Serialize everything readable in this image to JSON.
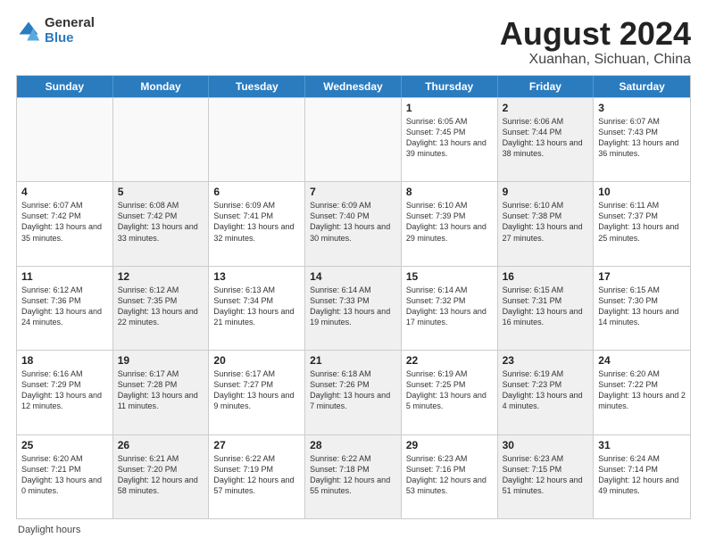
{
  "header": {
    "logo_general": "General",
    "logo_blue": "Blue",
    "title": "August 2024",
    "subtitle": "Xuanhan, Sichuan, China"
  },
  "days_of_week": [
    "Sunday",
    "Monday",
    "Tuesday",
    "Wednesday",
    "Thursday",
    "Friday",
    "Saturday"
  ],
  "weeks": [
    [
      {
        "day": "",
        "info": "",
        "empty": true
      },
      {
        "day": "",
        "info": "",
        "empty": true
      },
      {
        "day": "",
        "info": "",
        "empty": true
      },
      {
        "day": "",
        "info": "",
        "empty": true
      },
      {
        "day": "1",
        "info": "Sunrise: 6:05 AM\nSunset: 7:45 PM\nDaylight: 13 hours\nand 39 minutes.",
        "empty": false
      },
      {
        "day": "2",
        "info": "Sunrise: 6:06 AM\nSunset: 7:44 PM\nDaylight: 13 hours\nand 38 minutes.",
        "empty": false,
        "shaded": true
      },
      {
        "day": "3",
        "info": "Sunrise: 6:07 AM\nSunset: 7:43 PM\nDaylight: 13 hours\nand 36 minutes.",
        "empty": false
      }
    ],
    [
      {
        "day": "4",
        "info": "Sunrise: 6:07 AM\nSunset: 7:42 PM\nDaylight: 13 hours\nand 35 minutes.",
        "empty": false
      },
      {
        "day": "5",
        "info": "Sunrise: 6:08 AM\nSunset: 7:42 PM\nDaylight: 13 hours\nand 33 minutes.",
        "empty": false,
        "shaded": true
      },
      {
        "day": "6",
        "info": "Sunrise: 6:09 AM\nSunset: 7:41 PM\nDaylight: 13 hours\nand 32 minutes.",
        "empty": false
      },
      {
        "day": "7",
        "info": "Sunrise: 6:09 AM\nSunset: 7:40 PM\nDaylight: 13 hours\nand 30 minutes.",
        "empty": false,
        "shaded": true
      },
      {
        "day": "8",
        "info": "Sunrise: 6:10 AM\nSunset: 7:39 PM\nDaylight: 13 hours\nand 29 minutes.",
        "empty": false
      },
      {
        "day": "9",
        "info": "Sunrise: 6:10 AM\nSunset: 7:38 PM\nDaylight: 13 hours\nand 27 minutes.",
        "empty": false,
        "shaded": true
      },
      {
        "day": "10",
        "info": "Sunrise: 6:11 AM\nSunset: 7:37 PM\nDaylight: 13 hours\nand 25 minutes.",
        "empty": false
      }
    ],
    [
      {
        "day": "11",
        "info": "Sunrise: 6:12 AM\nSunset: 7:36 PM\nDaylight: 13 hours\nand 24 minutes.",
        "empty": false
      },
      {
        "day": "12",
        "info": "Sunrise: 6:12 AM\nSunset: 7:35 PM\nDaylight: 13 hours\nand 22 minutes.",
        "empty": false,
        "shaded": true
      },
      {
        "day": "13",
        "info": "Sunrise: 6:13 AM\nSunset: 7:34 PM\nDaylight: 13 hours\nand 21 minutes.",
        "empty": false
      },
      {
        "day": "14",
        "info": "Sunrise: 6:14 AM\nSunset: 7:33 PM\nDaylight: 13 hours\nand 19 minutes.",
        "empty": false,
        "shaded": true
      },
      {
        "day": "15",
        "info": "Sunrise: 6:14 AM\nSunset: 7:32 PM\nDaylight: 13 hours\nand 17 minutes.",
        "empty": false
      },
      {
        "day": "16",
        "info": "Sunrise: 6:15 AM\nSunset: 7:31 PM\nDaylight: 13 hours\nand 16 minutes.",
        "empty": false,
        "shaded": true
      },
      {
        "day": "17",
        "info": "Sunrise: 6:15 AM\nSunset: 7:30 PM\nDaylight: 13 hours\nand 14 minutes.",
        "empty": false
      }
    ],
    [
      {
        "day": "18",
        "info": "Sunrise: 6:16 AM\nSunset: 7:29 PM\nDaylight: 13 hours\nand 12 minutes.",
        "empty": false
      },
      {
        "day": "19",
        "info": "Sunrise: 6:17 AM\nSunset: 7:28 PM\nDaylight: 13 hours\nand 11 minutes.",
        "empty": false,
        "shaded": true
      },
      {
        "day": "20",
        "info": "Sunrise: 6:17 AM\nSunset: 7:27 PM\nDaylight: 13 hours\nand 9 minutes.",
        "empty": false
      },
      {
        "day": "21",
        "info": "Sunrise: 6:18 AM\nSunset: 7:26 PM\nDaylight: 13 hours\nand 7 minutes.",
        "empty": false,
        "shaded": true
      },
      {
        "day": "22",
        "info": "Sunrise: 6:19 AM\nSunset: 7:25 PM\nDaylight: 13 hours\nand 5 minutes.",
        "empty": false
      },
      {
        "day": "23",
        "info": "Sunrise: 6:19 AM\nSunset: 7:23 PM\nDaylight: 13 hours\nand 4 minutes.",
        "empty": false,
        "shaded": true
      },
      {
        "day": "24",
        "info": "Sunrise: 6:20 AM\nSunset: 7:22 PM\nDaylight: 13 hours\nand 2 minutes.",
        "empty": false
      }
    ],
    [
      {
        "day": "25",
        "info": "Sunrise: 6:20 AM\nSunset: 7:21 PM\nDaylight: 13 hours\nand 0 minutes.",
        "empty": false
      },
      {
        "day": "26",
        "info": "Sunrise: 6:21 AM\nSunset: 7:20 PM\nDaylight: 12 hours\nand 58 minutes.",
        "empty": false,
        "shaded": true
      },
      {
        "day": "27",
        "info": "Sunrise: 6:22 AM\nSunset: 7:19 PM\nDaylight: 12 hours\nand 57 minutes.",
        "empty": false
      },
      {
        "day": "28",
        "info": "Sunrise: 6:22 AM\nSunset: 7:18 PM\nDaylight: 12 hours\nand 55 minutes.",
        "empty": false,
        "shaded": true
      },
      {
        "day": "29",
        "info": "Sunrise: 6:23 AM\nSunset: 7:16 PM\nDaylight: 12 hours\nand 53 minutes.",
        "empty": false
      },
      {
        "day": "30",
        "info": "Sunrise: 6:23 AM\nSunset: 7:15 PM\nDaylight: 12 hours\nand 51 minutes.",
        "empty": false,
        "shaded": true
      },
      {
        "day": "31",
        "info": "Sunrise: 6:24 AM\nSunset: 7:14 PM\nDaylight: 12 hours\nand 49 minutes.",
        "empty": false
      }
    ]
  ],
  "footer": "Daylight hours"
}
